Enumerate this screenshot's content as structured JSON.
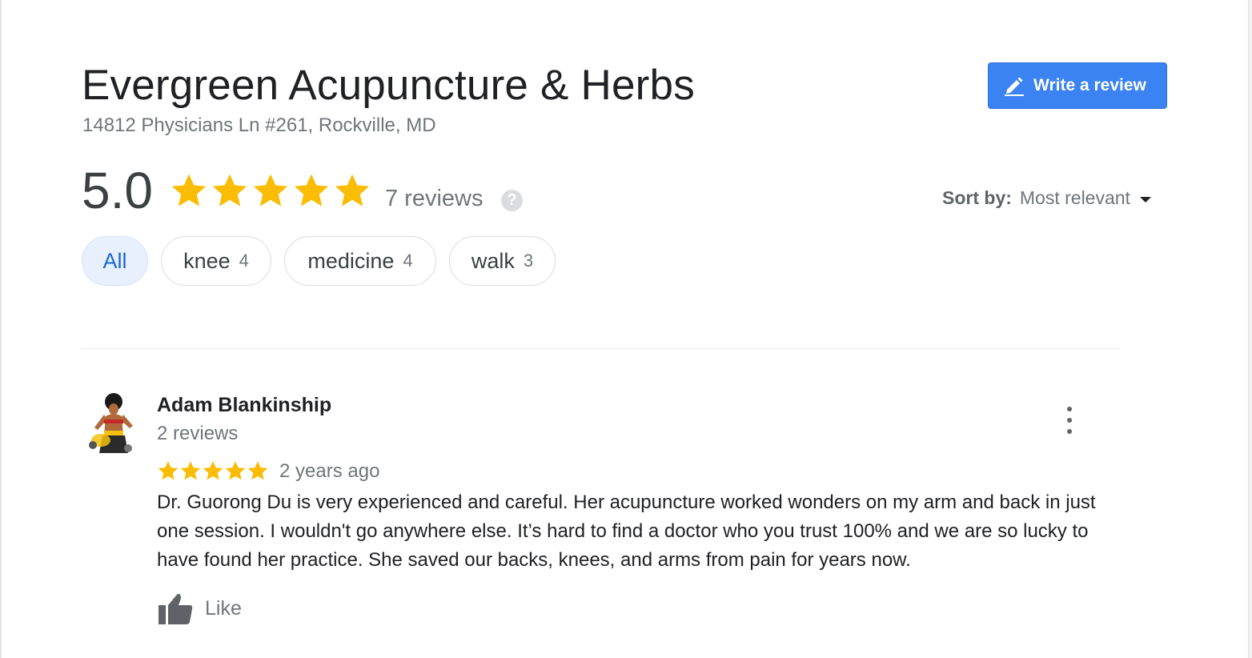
{
  "business": {
    "name": "Evergreen Acupuncture & Herbs",
    "address": "14812 Physicians Ln #261, Rockville, MD"
  },
  "actions": {
    "write_review_label": "Write a review",
    "write_review_icon": "pencil-icon"
  },
  "summary": {
    "rating": "5.0",
    "stars": 5,
    "review_count": "7 reviews",
    "help_icon": "?",
    "star_color": "#fbbc04"
  },
  "sort": {
    "label": "Sort by:",
    "value": "Most relevant"
  },
  "filters": [
    {
      "label": "All",
      "count": "",
      "active": true
    },
    {
      "label": "knee",
      "count": "4",
      "active": false
    },
    {
      "label": "medicine",
      "count": "4",
      "active": false
    },
    {
      "label": "walk",
      "count": "3",
      "active": false
    }
  ],
  "reviews": [
    {
      "author": "Adam Blankinship",
      "author_reviews": "2 reviews",
      "stars": 5,
      "date": "2 years ago",
      "text": "Dr. Guorong Du is very experienced and careful. Her acupuncture worked wonders on my arm and back in just one session. I wouldn't go anywhere else. It’s hard to find a doctor who you trust 100% and we are so lucky to have found her practice. She saved our backs, knees, and arms from pain for years now.",
      "like_label": "Like"
    }
  ],
  "colors": {
    "accent": "#3b82f3",
    "chip_active_bg": "#e8f0fe",
    "chip_active_text": "#1967d2"
  }
}
